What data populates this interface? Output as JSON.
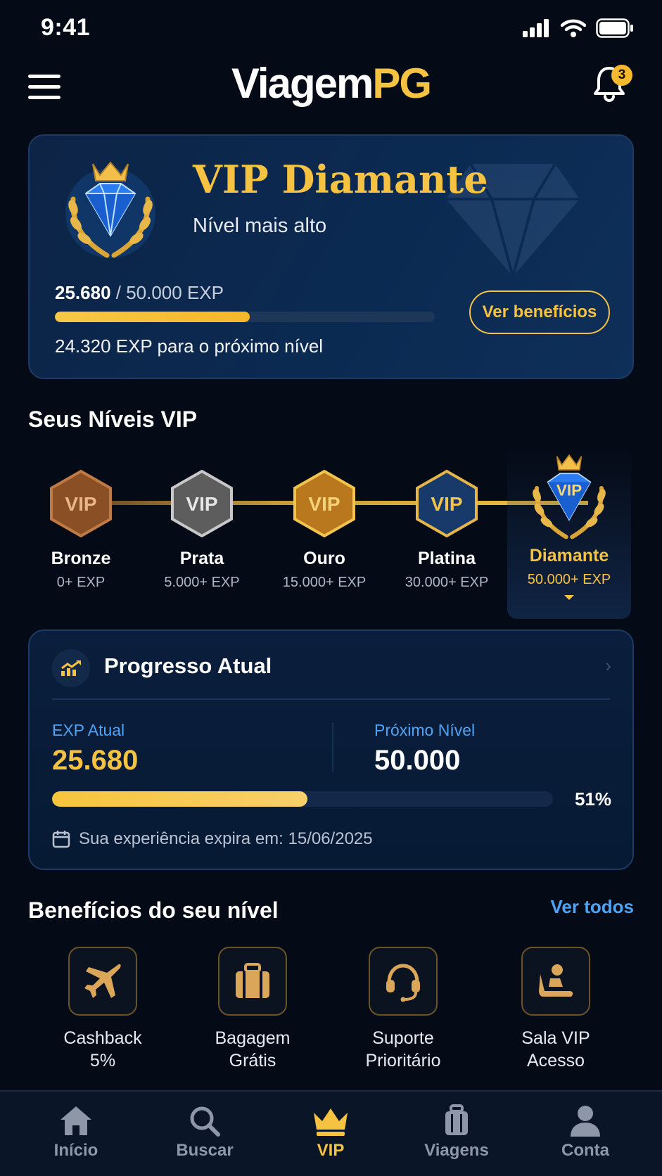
{
  "status_bar": {
    "time": "9:41"
  },
  "header": {
    "brand_part1": "Viagem",
    "brand_part2": "PG",
    "notification_count": "3"
  },
  "vip_card": {
    "title": "VIP Diamante",
    "subtitle": "Nível mais alto",
    "exp_current": "25.680",
    "exp_separator": " / ",
    "exp_total": "50.000 EXP",
    "exp_progress_fraction": 0.5136,
    "exp_remaining_text": "24.320 EXP para o próximo nível",
    "benefits_button": "Ver benefícios"
  },
  "levels_section": {
    "title": "Seus Níveis VIP",
    "levels": [
      {
        "name": "Bronze",
        "exp": "0+ EXP",
        "badge": "VIP",
        "color": "#8a4f24"
      },
      {
        "name": "Prata",
        "exp": "5.000+ EXP",
        "badge": "VIP",
        "color": "#6f6f6f"
      },
      {
        "name": "Ouro",
        "exp": "15.000+ EXP",
        "badge": "VIP",
        "color": "#b9771e"
      },
      {
        "name": "Platina",
        "exp": "30.000+ EXP",
        "badge": "VIP",
        "color": "#183a6b"
      },
      {
        "name": "Diamante",
        "exp": "50.000+ EXP",
        "badge": "VIP",
        "color": "#1f6fe0"
      }
    ],
    "active_level": "Diamante"
  },
  "progress_card": {
    "title": "Progresso Atual",
    "current_label": "EXP Atual",
    "current_value": "25.680",
    "next_label": "Próximo Nível",
    "next_value": "50.000",
    "percent": "51%",
    "progress_fraction": 0.51,
    "expire_text": "Sua experiência expira em: 15/06/2025"
  },
  "benefits_section": {
    "title": "Benefícios do seu nível",
    "see_all": "Ver todos",
    "items": [
      {
        "line1": "Cashback",
        "line2": "5%",
        "icon": "airplane-icon"
      },
      {
        "line1": "Bagagem",
        "line2": "Grátis",
        "icon": "luggage-icon"
      },
      {
        "line1": "Suporte",
        "line2": "Prioritário",
        "icon": "headset-icon"
      },
      {
        "line1": "Sala VIP",
        "line2": "Acesso",
        "icon": "lounge-seat-icon"
      }
    ]
  },
  "tab_bar": {
    "tabs": [
      {
        "label": "Início",
        "icon": "home-icon"
      },
      {
        "label": "Buscar",
        "icon": "search-icon"
      },
      {
        "label": "VIP",
        "icon": "crown-icon"
      },
      {
        "label": "Viagens",
        "icon": "suitcase-icon"
      },
      {
        "label": "Conta",
        "icon": "user-icon"
      }
    ],
    "active": "VIP"
  },
  "colors": {
    "accent_gold": "#f5c242",
    "link_blue": "#4ea3f5",
    "background": "#050b16"
  }
}
